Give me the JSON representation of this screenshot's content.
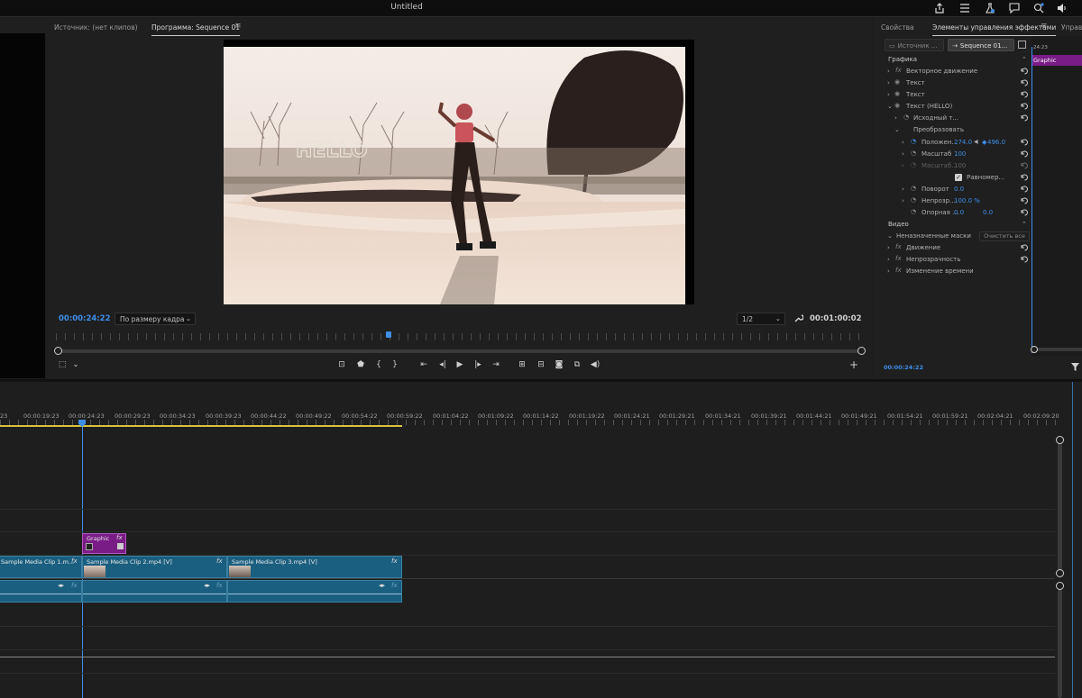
{
  "window": {
    "title": "Untitled"
  },
  "source_monitor": {
    "tab_source": "Источник: (нет клипов)",
    "tab_program": "Программа: Sequence 01",
    "menu_icon": "hamburger-icon"
  },
  "program": {
    "timecode_current": "00:00:24:22",
    "fit_select": "По размеру кадра",
    "resolution_select": "1/2",
    "timecode_duration": "00:01:00:02",
    "overlay_text": "HELLO"
  },
  "effects_panel": {
    "tab_properties": "Свойства",
    "tab_effect_controls": "Элементы управления эффектами",
    "tab_more": "Управ",
    "source_tab": "Источник ...",
    "sequence_tab": "Sequence 01...",
    "mini_timecode": "24:23",
    "graphic_clip_label": "Graphic",
    "section_graphics": "Графика",
    "rows": [
      {
        "label": "Векторное движение",
        "kind": "fx"
      },
      {
        "label": "Текст",
        "kind": "eye"
      },
      {
        "label": "Текст",
        "kind": "eye"
      },
      {
        "label": "Текст (HELLO)",
        "kind": "eye-open"
      },
      {
        "label": "Исходный т...",
        "kind": "stopwatch"
      },
      {
        "label": "Преобразовать",
        "kind": "group"
      }
    ],
    "position": {
      "label": "Положен...",
      "x": "274.0",
      "y": "496.0"
    },
    "scale": {
      "label": "Масштаб",
      "value": "100"
    },
    "scale_width": {
      "label": "Масштаб...",
      "value": "100"
    },
    "uniform": {
      "label": "Равномер..."
    },
    "rotation": {
      "label": "Поворот",
      "value": "0.0"
    },
    "opacity": {
      "label": "Непрозр...",
      "value": "100.0 %"
    },
    "anchor": {
      "label": "Опорная ...",
      "x": "0.0",
      "y": "0.0"
    },
    "section_video": "Видео",
    "masks_label": "Неназначенные маски",
    "clear_all": "Очистить все",
    "video_rows": [
      "Движение",
      "Непрозрачность",
      "Изменение времени"
    ],
    "footer_timecode": "00:00:24:22"
  },
  "timeline": {
    "ruler": [
      "23",
      "00:00:19:23",
      "00:00:24:23",
      "00:00:29:23",
      "00:00:34:23",
      "00:00:39:23",
      "00:00:44:22",
      "00:00:49:22",
      "00:00:54:22",
      "00:00:59:22",
      "00:01:04:22",
      "00:01:09:22",
      "00:01:14:22",
      "00:01:19:22",
      "00:01:24:21",
      "00:01:29:21",
      "00:01:34:21",
      "00:01:39:21",
      "00:01:44:21",
      "00:01:49:21",
      "00:01:54:21",
      "00:01:59:21",
      "00:02:04:21",
      "00:02:09:20"
    ],
    "graphic_clip": "Graphic",
    "video_clips": [
      "Sample Media Clip 1.m...",
      "Sample Media Clip 2.mp4 [V]",
      "Sample Media Clip 3.mp4 [V]"
    ],
    "fx_label": "fx"
  },
  "colors": {
    "accent": "#3e8ee8",
    "clip_video": "#1a5f80",
    "clip_graphic": "#7a1c86",
    "work_area": "#d8c33a"
  }
}
